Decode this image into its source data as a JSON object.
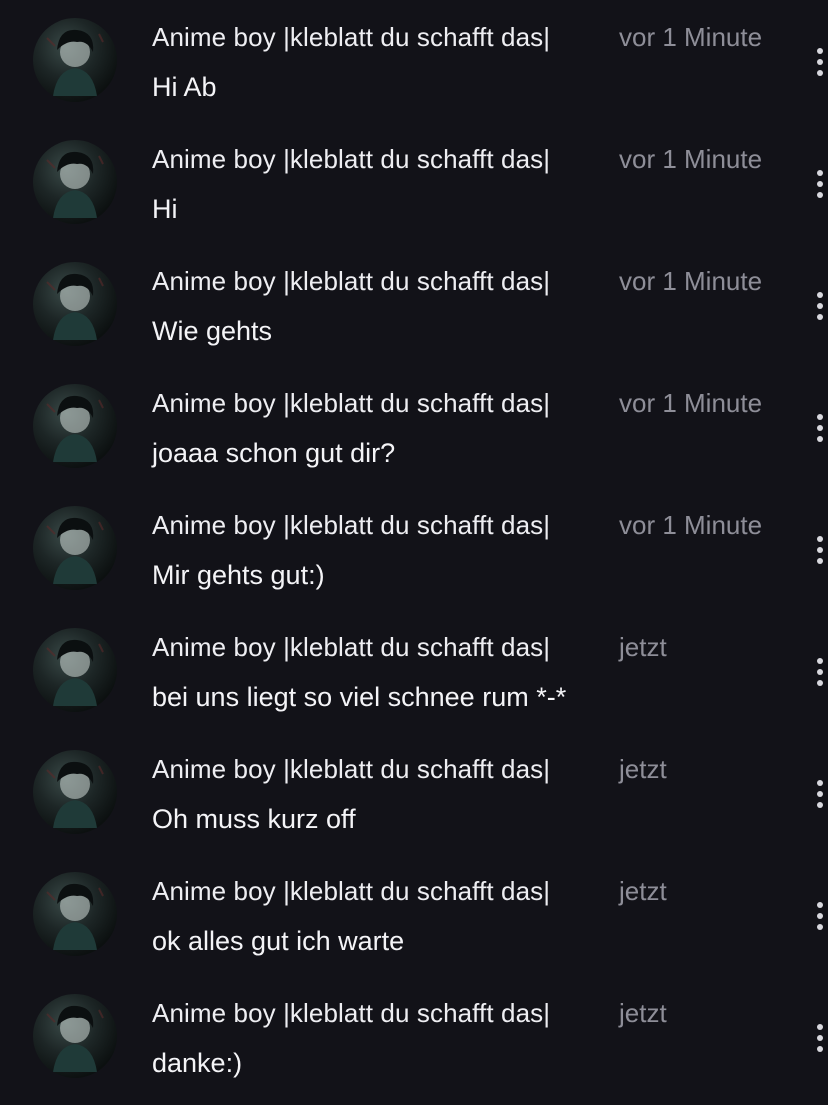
{
  "icons": {
    "avatar": "user-avatar-icon",
    "more": "more-options-icon"
  },
  "colors": {
    "background": "#121218",
    "author_text": "#eeeef2",
    "timestamp_text": "#8e8e98",
    "message_text": "#f4f4f7"
  },
  "messages": [
    {
      "author": "Anime boy |kleblatt du schafft das|",
      "time": "vor 1 Minute",
      "text": "Hi Ab"
    },
    {
      "author": "Anime boy |kleblatt du schafft das|",
      "time": "vor 1 Minute",
      "text": "Hi"
    },
    {
      "author": "Anime boy |kleblatt du schafft das|",
      "time": "vor 1 Minute",
      "text": "Wie gehts"
    },
    {
      "author": "Anime boy |kleblatt du schafft das|",
      "time": "vor 1 Minute",
      "text": "joaaa schon gut dir?"
    },
    {
      "author": "Anime boy |kleblatt du schafft das|",
      "time": "vor 1 Minute",
      "text": "Mir gehts gut:)"
    },
    {
      "author": "Anime boy |kleblatt du schafft das|",
      "time": "jetzt",
      "text": "bei uns liegt so viel schnee rum *-*"
    },
    {
      "author": "Anime boy |kleblatt du schafft das|",
      "time": "jetzt",
      "text": "Oh muss kurz off"
    },
    {
      "author": "Anime boy |kleblatt du schafft das|",
      "time": "jetzt",
      "text": "ok alles gut ich warte"
    },
    {
      "author": "Anime boy |kleblatt du schafft das|",
      "time": "jetzt",
      "text": "danke:)"
    }
  ]
}
